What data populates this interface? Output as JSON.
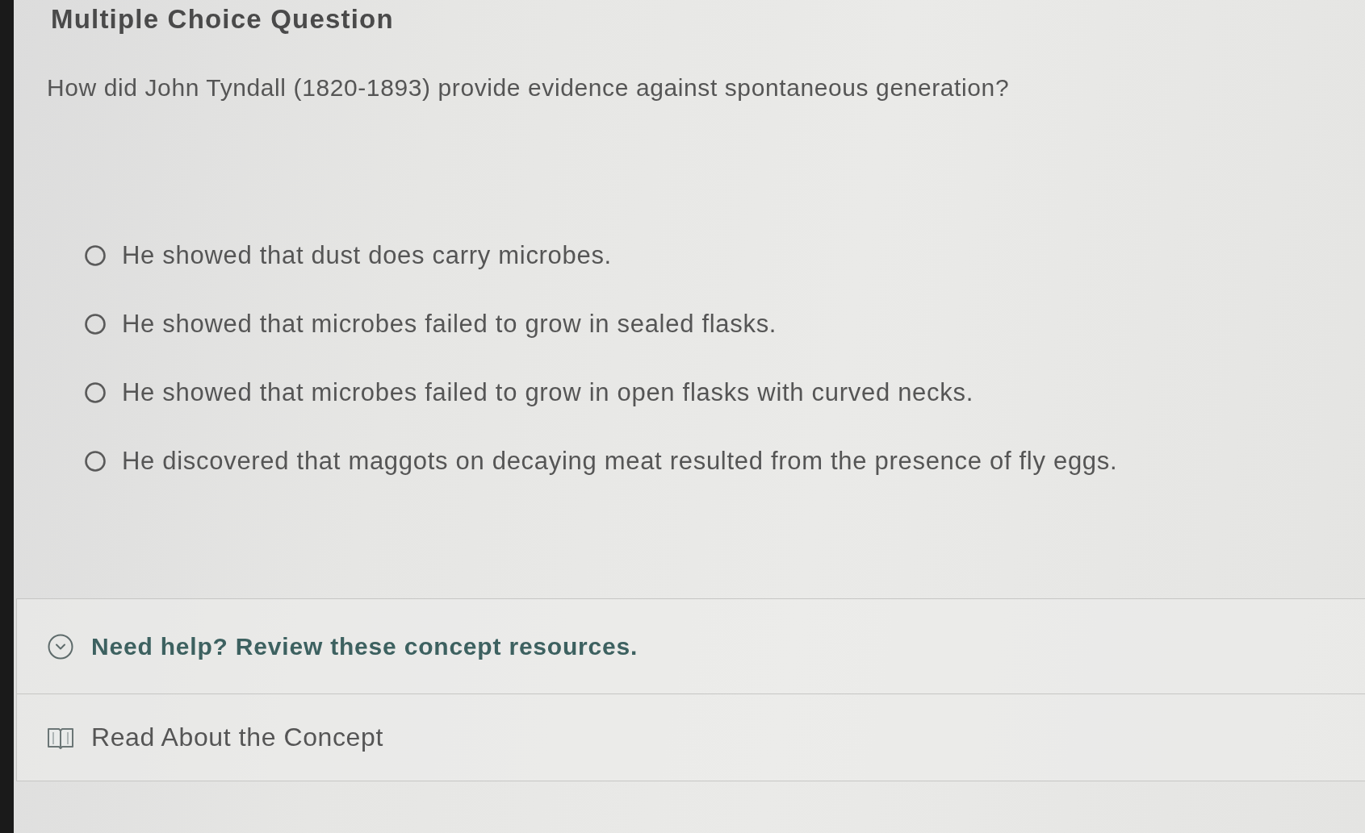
{
  "header": {
    "title": "Multiple Choice Question"
  },
  "question": {
    "text": "How did John Tyndall (1820-1893) provide evidence against spontaneous generation?"
  },
  "options": [
    {
      "label": "He showed that dust does carry microbes.",
      "selected": false
    },
    {
      "label": "He showed that microbes failed to grow in sealed flasks.",
      "selected": false
    },
    {
      "label": "He showed that microbes failed to grow in open flasks with curved necks.",
      "selected": false
    },
    {
      "label": "He discovered that maggots on decaying meat resulted from the presence of fly eggs.",
      "selected": false
    }
  ],
  "help": {
    "title": "Need help? Review these concept resources.",
    "expanded": true,
    "resources": [
      {
        "label": "Read About the Concept"
      }
    ]
  }
}
